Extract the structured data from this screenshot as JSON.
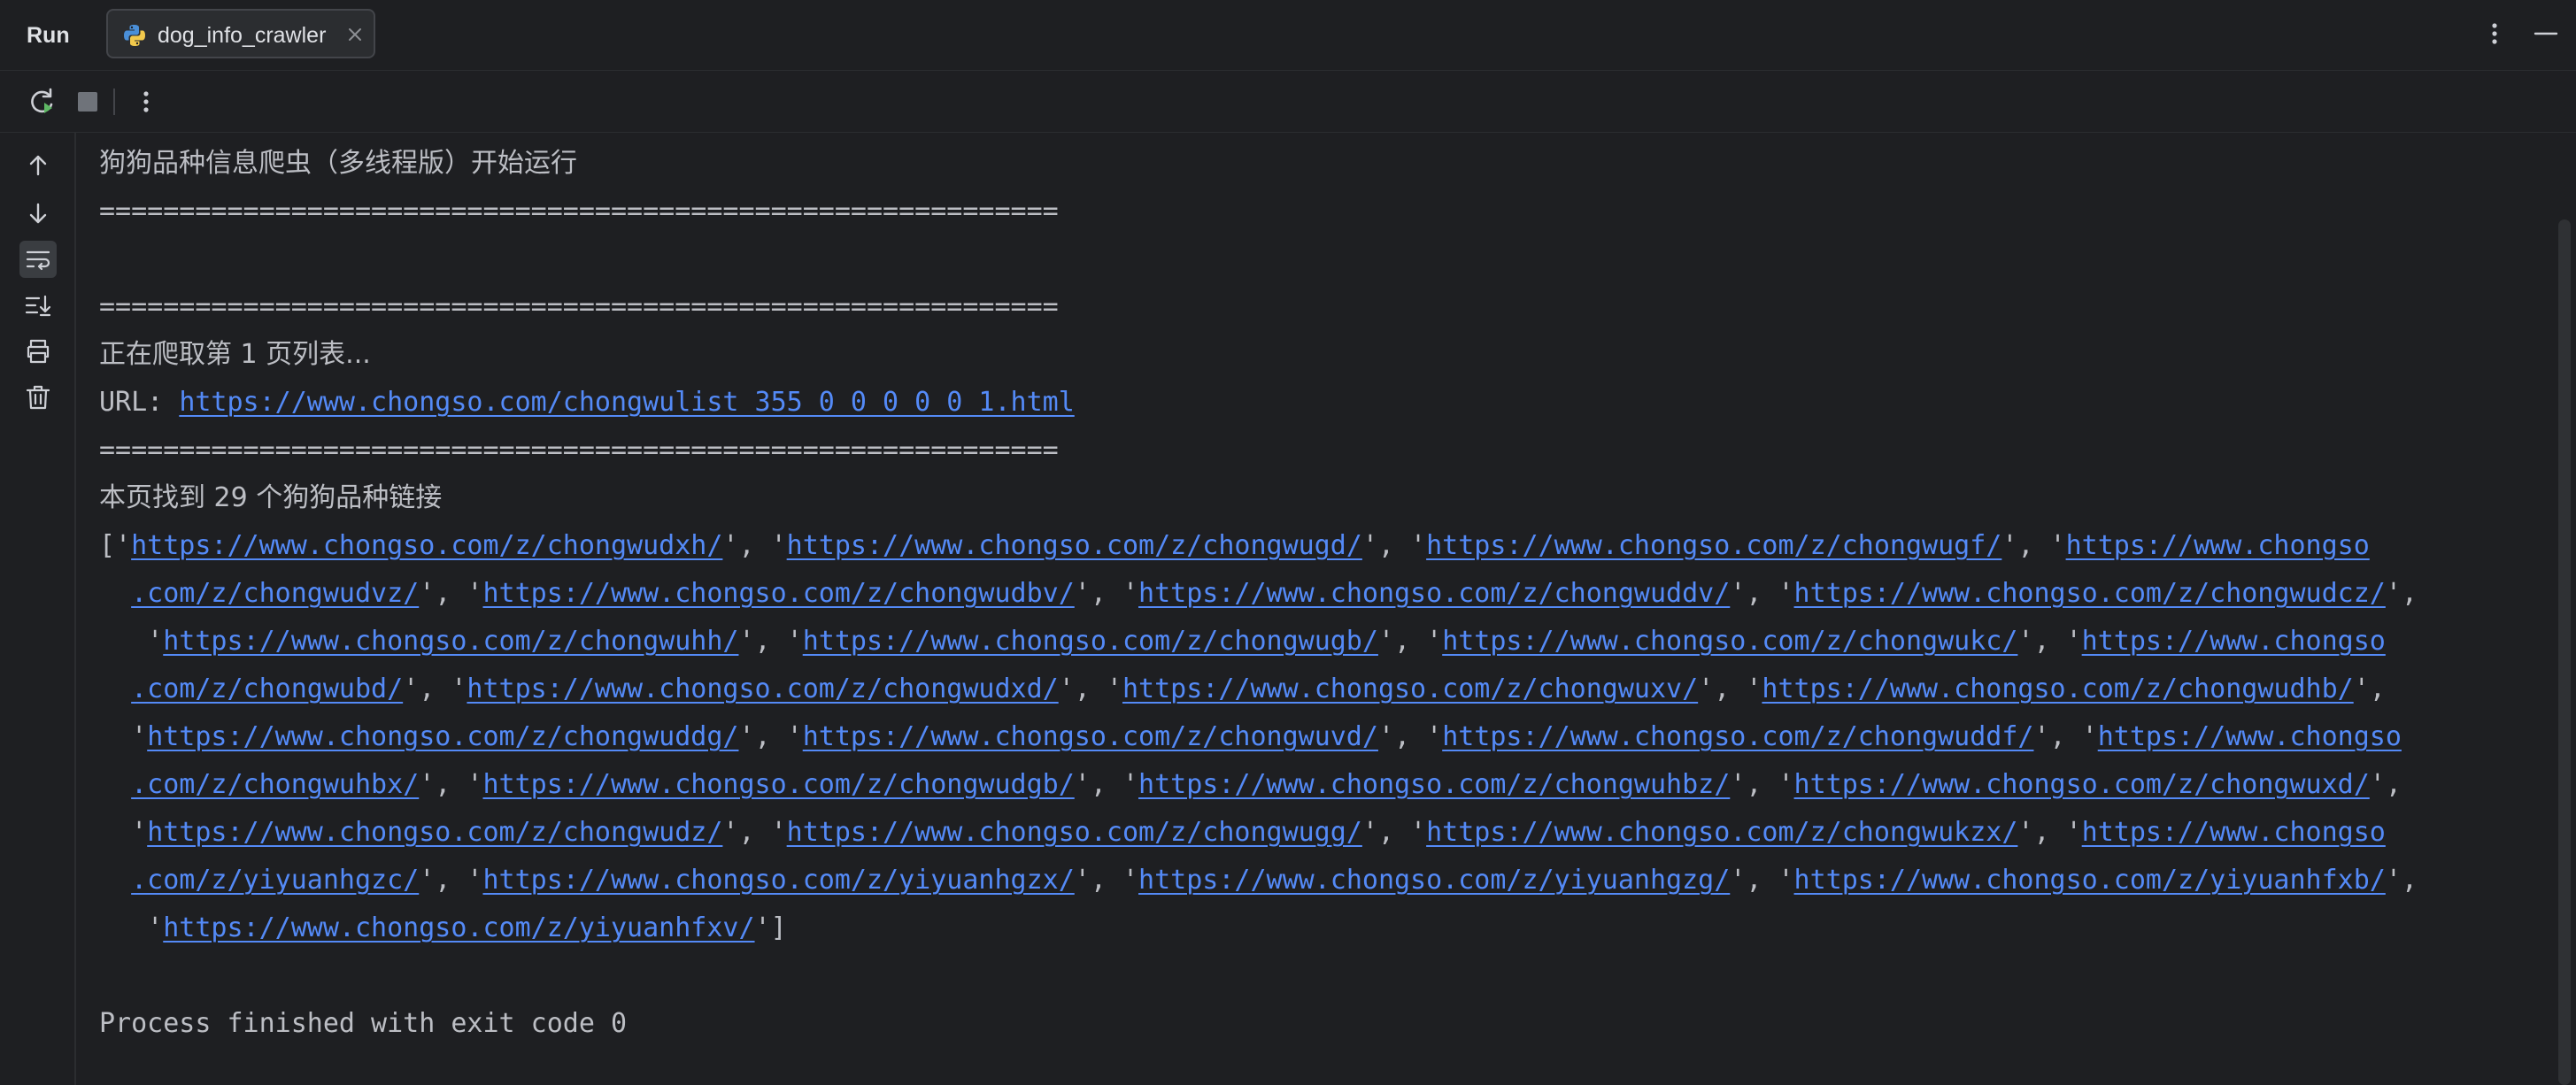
{
  "header": {
    "run_label": "Run",
    "tab_label": "dog_info_crawler"
  },
  "colors": {
    "background": "#1e1f22",
    "text": "#bcbec4",
    "link": "#548af7",
    "run_green": "#5fb865"
  },
  "icons": {
    "tab": "python-icon",
    "tab_close": "close-icon",
    "header_more": "vertical-ellipsis-icon",
    "header_minimize": "minimize-icon",
    "rerun": "rerun-icon",
    "stop": "stop-icon",
    "toolbar_more": "vertical-ellipsis-icon",
    "gutter": [
      "arrow-up-icon",
      "arrow-down-icon",
      "soft-wrap-icon",
      "scroll-to-end-icon",
      "print-icon",
      "trash-icon"
    ]
  },
  "console": {
    "title_line": "狗狗品种信息爬虫（多线程版）开始运行",
    "separator": "============================================================",
    "crawling_page": "正在爬取第 1 页列表...",
    "url_prefix": "URL: ",
    "url": "https://www.chongso.com/chongwulist_355_0_0_0_0_0_1.html",
    "found_count": "本页找到 29 个狗狗品种链接",
    "links": [
      "https://www.chongso.com/z/chongwudxh/",
      "https://www.chongso.com/z/chongwugd/",
      "https://www.chongso.com/z/chongwugf/",
      "https://www.chongso.com/z/chongwudvz/",
      "https://www.chongso.com/z/chongwudbv/",
      "https://www.chongso.com/z/chongwuddv/",
      "https://www.chongso.com/z/chongwudcz/",
      "https://www.chongso.com/z/chongwuhh/",
      "https://www.chongso.com/z/chongwugb/",
      "https://www.chongso.com/z/chongwukc/",
      "https://www.chongso.com/z/chongwubd/",
      "https://www.chongso.com/z/chongwudxd/",
      "https://www.chongso.com/z/chongwuxv/",
      "https://www.chongso.com/z/chongwudhb/",
      "https://www.chongso.com/z/chongwuddg/",
      "https://www.chongso.com/z/chongwuvd/",
      "https://www.chongso.com/z/chongwuddf/",
      "https://www.chongso.com/z/chongwuhbx/",
      "https://www.chongso.com/z/chongwudgb/",
      "https://www.chongso.com/z/chongwuhbz/",
      "https://www.chongso.com/z/chongwuxd/",
      "https://www.chongso.com/z/chongwudz/",
      "https://www.chongso.com/z/chongwugg/",
      "https://www.chongso.com/z/chongwukzx/",
      "https://www.chongso.com/z/yiyuanhgzc/",
      "https://www.chongso.com/z/yiyuanhgzx/",
      "https://www.chongso.com/z/yiyuanhgzg/",
      "https://www.chongso.com/z/yiyuanhfxb/",
      "https://www.chongso.com/z/yiyuanhfxv/"
    ],
    "exit_message": "Process finished with exit code 0"
  }
}
